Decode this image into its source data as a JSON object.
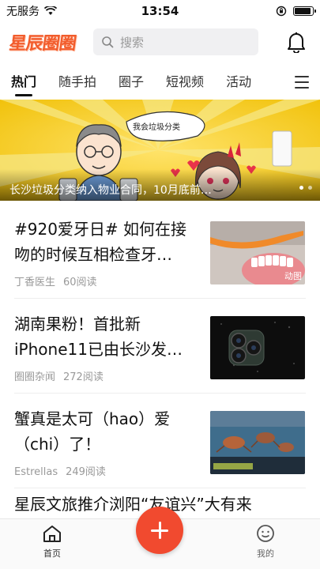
{
  "status_bar": {
    "carrier": "无服务",
    "time": "13:54",
    "battery_level": 0.9
  },
  "header": {
    "logo_text": "星辰圈圈",
    "search_placeholder": "搜索"
  },
  "tabs": [
    {
      "label": "热门",
      "active": true
    },
    {
      "label": "随手拍",
      "active": false
    },
    {
      "label": "圈子",
      "active": false
    },
    {
      "label": "短视频",
      "active": false
    },
    {
      "label": "活动",
      "active": false
    }
  ],
  "banner": {
    "caption": "长沙垃圾分类纳入物业合同，10月底前…",
    "bubble_text": "我会垃圾分类",
    "page_count": 2,
    "current_page": 1
  },
  "feed": [
    {
      "title": "#920爱牙日# 如何在接吻的时候互相检查牙…",
      "author": "丁香医生",
      "reads": "60阅读",
      "badge": "动图",
      "thumb_icon": "teeth-brush-image"
    },
    {
      "title": "湖南果粉！首批新iPhone11已由长沙发…",
      "author": "圈圈杂闻",
      "reads": "272阅读",
      "badge": "",
      "thumb_icon": "iphone-camera-image"
    },
    {
      "title": "蟹真是太可（hao）爱（chi）了！",
      "author": "Estrellas",
      "reads": "249阅读",
      "badge": "",
      "thumb_icon": "crab-image"
    }
  ],
  "feed_partial_title": "星辰文旅推介浏阳“友谊兴”大有来",
  "bottom_nav": {
    "home_label": "首页",
    "me_label": "我的"
  }
}
